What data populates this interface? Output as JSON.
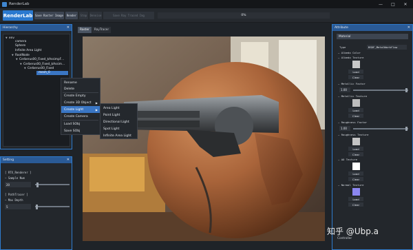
{
  "window": {
    "title": "RenderLab"
  },
  "toolbar": {
    "brand": "RenderLab",
    "buttons": [
      {
        "label": "Save Raster Image",
        "disabled": false
      },
      {
        "label": "Render",
        "disabled": false
      },
      {
        "label": "Stop",
        "disabled": true
      },
      {
        "label": "Denoise",
        "disabled": true
      },
      {
        "label": "Save Ray Traced Img",
        "disabled": true
      }
    ],
    "progress": {
      "value": 0,
      "label": "0%"
    }
  },
  "hierarchy": {
    "title": "Hierarchy",
    "items": [
      {
        "label": "env",
        "expanded": true
      },
      {
        "label": "camera"
      },
      {
        "label": "Sphere"
      },
      {
        "label": "Infinite Area Light"
      },
      {
        "label": "RootNode",
        "expanded": true
      },
      {
        "label": "Cerberus00_Fixed_$AssimpF…",
        "expanded": true
      },
      {
        "label": "Cerberus00_Fixed_$Assim…",
        "expanded": true
      },
      {
        "label": "Cerberus00_Fixed",
        "expanded": true
      },
      {
        "label": "mesh_0",
        "selected": true
      }
    ]
  },
  "context_menu": {
    "items": [
      "Rename",
      "Delete",
      "Create Empty",
      "Create 3D Object",
      "Create Light",
      "Create Camera",
      "Load SObj",
      "Save SObj"
    ],
    "highlighted": "Create Light"
  },
  "light_submenu": {
    "items": [
      "Area Light",
      "Point Light",
      "Directional Light",
      "Spot Light",
      "Infinite Area Light"
    ]
  },
  "setting": {
    "title": "Setting",
    "rt_renderer": "[ RTX_Renderer ]",
    "sample_num_label": "Sample Num",
    "sample_num_value": "20",
    "path_tracer": "[ PathTracer ]",
    "max_depth_label": "Max Depth",
    "max_depth_value": "5"
  },
  "viewport": {
    "tabs": [
      {
        "label": "Raster",
        "active": true
      },
      {
        "label": "RayTracer",
        "active": false
      }
    ]
  },
  "attribute": {
    "title": "Attribute",
    "section": "Material",
    "type_label": "Type",
    "type_value": "BSDF_MetalWorkflow",
    "albedo_color_label": "Albedo Color",
    "albedo_texture_label": "Albedo Texture",
    "load_label": "Load",
    "clear_label": "Clear",
    "metallic_factor_label": "Metallic Factor",
    "metallic_factor_value": "1.00",
    "metallic_texture_label": "Metallic Texture",
    "roughness_factor_label": "Roughness Factor",
    "roughness_factor_value": "1.00",
    "roughness_texture_label": "Roughness Texture",
    "ao_texture_label": "AO Texture",
    "normal_texture_label": "Normal Texture",
    "controller_label": "Controller"
  },
  "watermark": "知乎 @Ubp.a",
  "colors": {
    "accent": "#2a79cf",
    "panel_header": "#2a5a96",
    "selection": "#3a76c4",
    "normal_map": "#8b86f0"
  }
}
